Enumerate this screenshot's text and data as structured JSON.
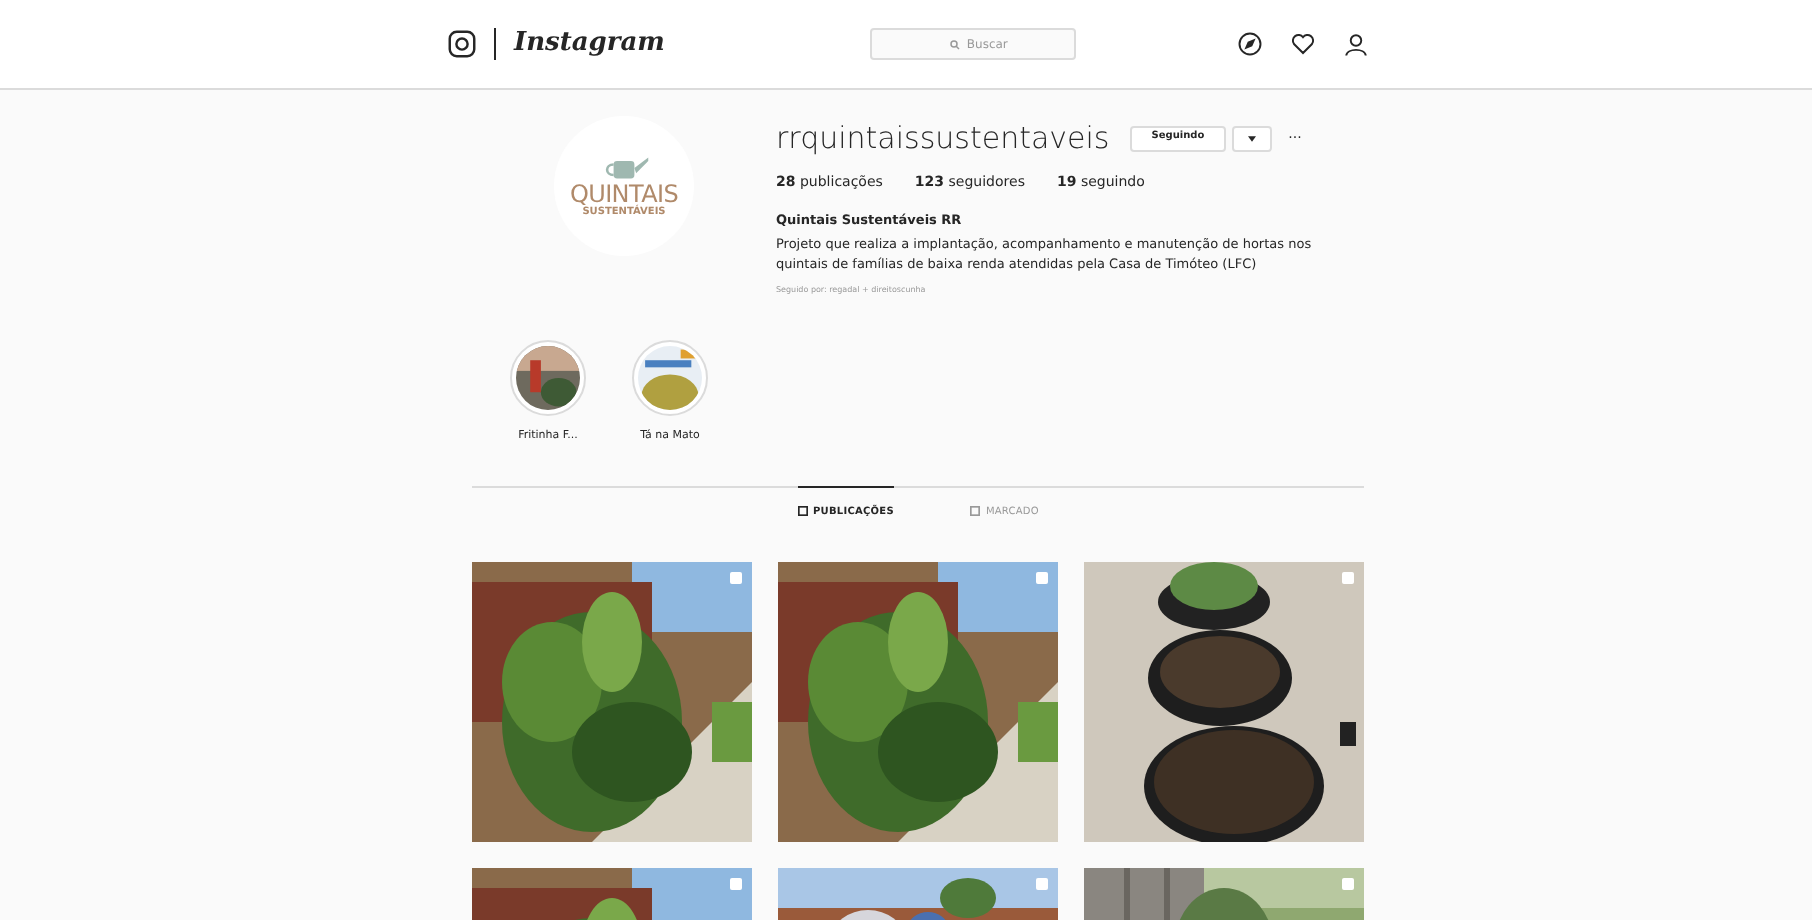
{
  "nav": {
    "logo": "Instagram",
    "search": {
      "placeholder": "Buscar"
    }
  },
  "profile": {
    "username": "rrquintaissustentaveis",
    "follow_button": "Seguindo",
    "more": "···",
    "stats": [
      {
        "count": "28",
        "label": "publicações"
      },
      {
        "count": "123",
        "label": "seguidores"
      },
      {
        "count": "19",
        "label": "seguindo"
      }
    ],
    "name": "Quintais Sustentáveis RR",
    "bio": "Projeto que realiza a implantação, acompanhamento e manutenção de hortas nos quintais de famílias de baixa renda atendidas pela Casa de Timóteo (LFC)",
    "followed_by": "Seguido por: regadal + direitoscunha",
    "avatar_text": [
      "QUINTAIS",
      "SUSTENTÁVEIS"
    ]
  },
  "highlights": [
    {
      "label": "Fritinha F..."
    },
    {
      "label": "Tá na Mato"
    }
  ],
  "tabs": [
    {
      "label": "PUBLICAÇÕES",
      "selected": true
    },
    {
      "label": "MARCADO",
      "selected": false
    }
  ],
  "posts": [
    {
      "kind": "plant",
      "multiple": true
    },
    {
      "kind": "plant",
      "multiple": true
    },
    {
      "kind": "tires",
      "multiple": true
    },
    {
      "kind": "plant",
      "multiple": true
    },
    {
      "kind": "people",
      "multiple": true
    },
    {
      "kind": "fence",
      "multiple": true
    }
  ]
}
